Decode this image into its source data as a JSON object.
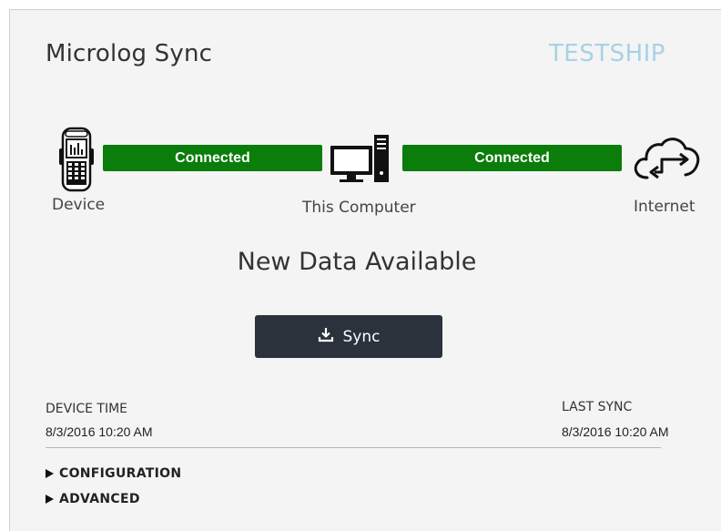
{
  "app": {
    "title": "Microlog Sync",
    "ship_name": "TESTSHIP"
  },
  "connections": {
    "device_to_computer": "Connected",
    "computer_to_internet": "Connected",
    "status_color": "#0a7d0a"
  },
  "nodes": {
    "device_label": "Device",
    "device_icon": "handheld-scanner-icon",
    "computer_label": "This Computer",
    "computer_icon": "desktop-computer-icon",
    "internet_label": "Internet",
    "internet_icon": "cloud-sync-icon"
  },
  "main": {
    "data_status": "New Data Available",
    "sync_button_label": "Sync",
    "sync_button_icon": "download-icon"
  },
  "times": {
    "device_time_label": "DEVICE TIME",
    "device_time_value": "8/3/2016 10:20 AM",
    "last_sync_label": "LAST SYNC",
    "last_sync_value": "8/3/2016 10:20 AM"
  },
  "sections": [
    {
      "label": "CONFIGURATION",
      "icon": "triangle-right-icon"
    },
    {
      "label": "ADVANCED",
      "icon": "triangle-right-icon"
    }
  ],
  "colors": {
    "accent_ship": "#a8d1e6",
    "button_bg": "#2b323b"
  }
}
